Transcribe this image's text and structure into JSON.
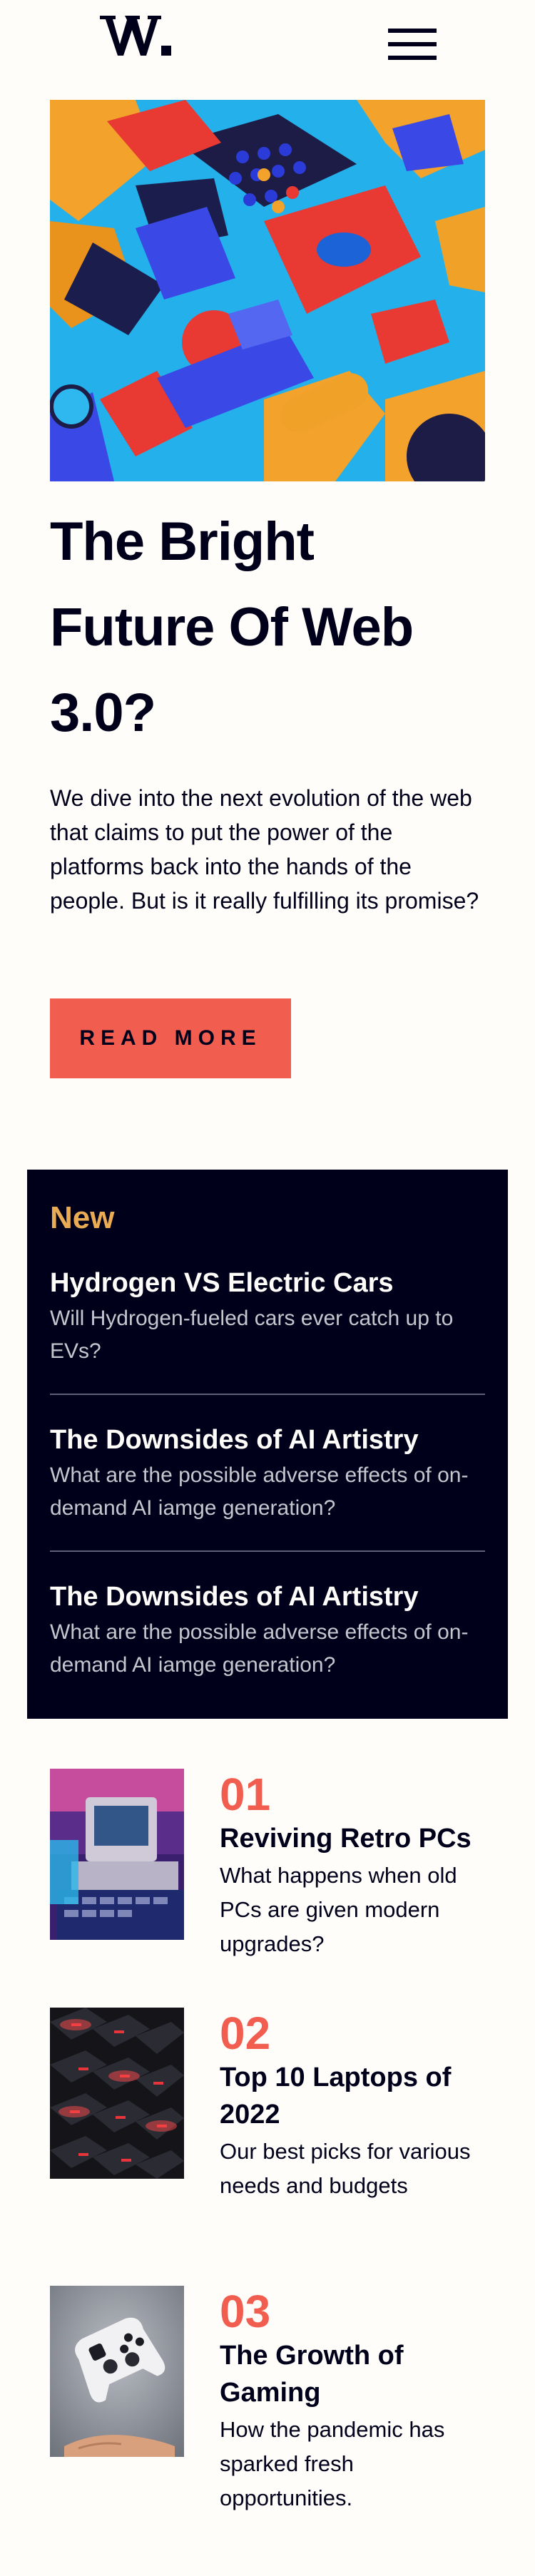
{
  "header": {
    "logo_text": "W.",
    "menu_label": "Menu"
  },
  "hero": {
    "image_alt": "Colorful abstract 3D geometric blocks",
    "title": "The Bright Future Of Web 3.0?",
    "description": "We dive into the next evolution of the web that claims to put the power of the platforms back into the hands of the people. But is it really fulfilling its promise?",
    "button_label": "READ MORE"
  },
  "new_panel": {
    "heading": "New",
    "items": [
      {
        "title": "Hydrogen VS Electric Cars",
        "description": "Will Hydrogen-fueled cars ever catch up to EVs?"
      },
      {
        "title": "The Downsides of AI Artistry",
        "description": "What are the possible adverse effects of on-demand AI iamge generation?"
      },
      {
        "title": "The Downsides of AI Artistry",
        "description": "What are the possible adverse effects of on-demand AI iamge generation?"
      }
    ]
  },
  "numbered": [
    {
      "number": "01",
      "title": "Reviving Retro PCs",
      "description": "What happens when old PCs are given modern upgrades?",
      "icon": "retro-pc-image"
    },
    {
      "number": "02",
      "title": "Top 10 Laptops of 2022",
      "description": "Our best picks for various needs and budgets",
      "icon": "laptop-keyboard-image"
    },
    {
      "number": "03",
      "title": "The Growth of Gaming",
      "description": "How the pandemic has sparked fresh opportunities.",
      "icon": "game-controller-image"
    }
  ],
  "colors": {
    "background": "#fffdfa",
    "dark": "#00001a",
    "accent_red": "#f15e50",
    "accent_orange": "#e9ab53",
    "muted": "#c5c6ce"
  }
}
